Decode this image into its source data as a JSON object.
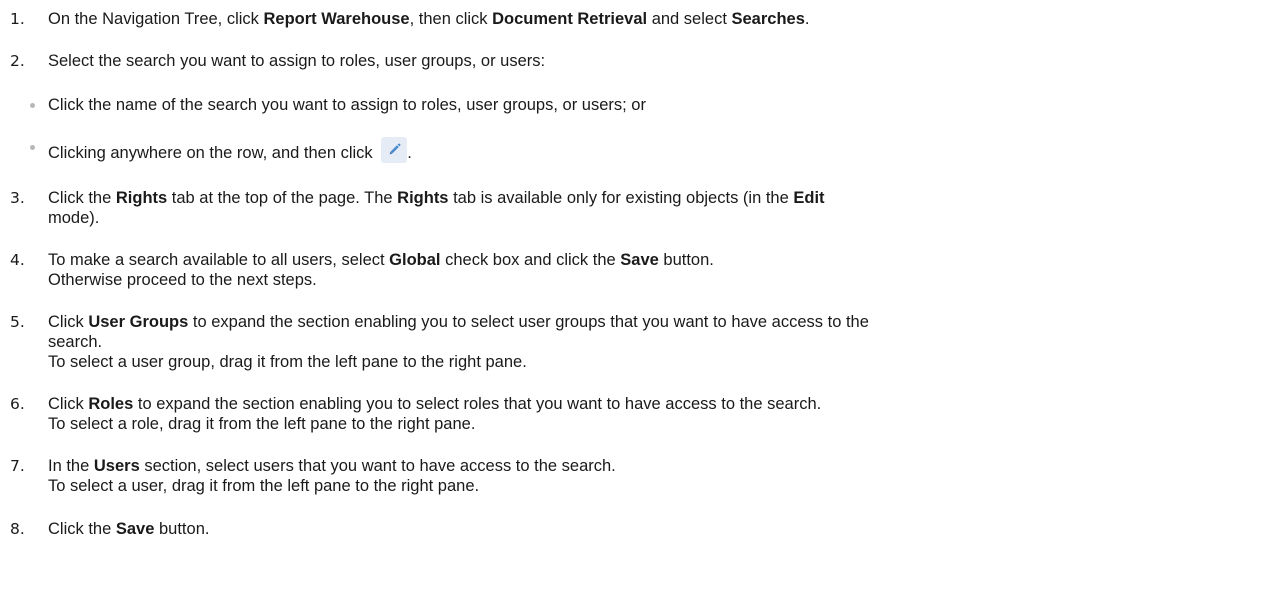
{
  "steps": [
    {
      "number": "1.",
      "lines": [
        [
          {
            "t": "On the Navigation Tree, click "
          },
          {
            "t": "Report Warehouse",
            "b": true
          },
          {
            "t": ", then click "
          },
          {
            "t": "Document Retrieval",
            "b": true
          },
          {
            "t": " and select "
          },
          {
            "t": "Searches",
            "b": true
          },
          {
            "t": "."
          }
        ]
      ]
    },
    {
      "number": "2.",
      "lines": [
        [
          {
            "t": "Select the search you want to assign to roles, user groups, or users:"
          }
        ]
      ]
    },
    {
      "number": "3.",
      "lines": [
        [
          {
            "t": "Click the "
          },
          {
            "t": "Rights",
            "b": true
          },
          {
            "t": " tab at the top of the page. The "
          },
          {
            "t": "Rights",
            "b": true
          },
          {
            "t": " tab is available only for existing objects (in the "
          },
          {
            "t": "Edit",
            "b": true
          }
        ],
        [
          {
            "t": "mode)."
          }
        ]
      ]
    },
    {
      "number": "4.",
      "lines": [
        [
          {
            "t": "To make a search available to all users, select "
          },
          {
            "t": "Global",
            "b": true
          },
          {
            "t": " check box and click the "
          },
          {
            "t": "Save",
            "b": true
          },
          {
            "t": " button."
          }
        ],
        [
          {
            "t": "Otherwise proceed to the next steps."
          }
        ]
      ]
    },
    {
      "number": "5.",
      "lines": [
        [
          {
            "t": "Click "
          },
          {
            "t": "User Groups",
            "b": true
          },
          {
            "t": " to expand the section enabling you to select user groups that you want to have access to the"
          }
        ],
        [
          {
            "t": "search."
          }
        ],
        [
          {
            "t": "To select a user group, drag it from the left pane to the right pane."
          }
        ]
      ]
    },
    {
      "number": "6.",
      "lines": [
        [
          {
            "t": "Click "
          },
          {
            "t": "Roles",
            "b": true
          },
          {
            "t": " to expand the section enabling you to select roles that you want to have access to the search."
          }
        ],
        [
          {
            "t": "To select a role, drag it from the left pane to the right pane."
          }
        ]
      ]
    },
    {
      "number": "7.",
      "lines": [
        [
          {
            "t": "In the "
          },
          {
            "t": "Users",
            "b": true
          },
          {
            "t": " section, select users that you want to have access to the search."
          }
        ],
        [
          {
            "t": "To select a user, drag it from the left pane to the right pane."
          }
        ]
      ]
    },
    {
      "number": "8.",
      "lines": [
        [
          {
            "t": "Click the "
          },
          {
            "t": "Save",
            "b": true
          },
          {
            "t": " button."
          }
        ]
      ]
    }
  ],
  "bullets": [
    "Click the name of the search you want to assign to roles, user groups, or users; or",
    "Clicking anywhere on the row, and then click"
  ],
  "bullet_trailing": ".",
  "edit_icon": {
    "name": "pencil-edit-icon",
    "background": "#e6ecf5",
    "color": "#4a8ad0"
  }
}
